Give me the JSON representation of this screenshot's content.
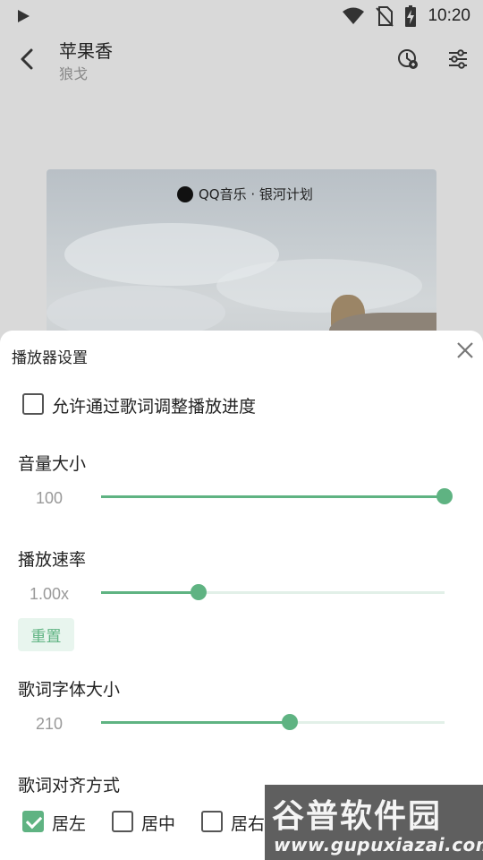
{
  "status_bar": {
    "time": "10:20"
  },
  "header": {
    "title": "苹果香",
    "artist": "狼戈"
  },
  "album_art": {
    "logo_text": "QQ音乐 · 银河计划"
  },
  "player_settings": {
    "title": "播放器设置",
    "lyrics_seek": {
      "label": "允许通过歌词调整播放进度",
      "checked": false
    },
    "volume": {
      "label": "音量大小",
      "value": "100",
      "fraction": 1.0
    },
    "speed": {
      "label": "播放速率",
      "value": "1.00x",
      "fraction": 0.285,
      "reset_label": "重置"
    },
    "font_size": {
      "label": "歌词字体大小",
      "value": "210",
      "fraction": 0.55
    },
    "alignment": {
      "label": "歌词对齐方式",
      "options": [
        {
          "label": "居左",
          "checked": true
        },
        {
          "label": "居中",
          "checked": false
        },
        {
          "label": "居右",
          "checked": false
        }
      ]
    }
  },
  "watermark": {
    "title": "谷普软件园",
    "url": "www.gupuxiazai.com"
  },
  "colors": {
    "accent": "#5fb382",
    "accent_light": "#e8f5ee",
    "scrim": "#d9d9d9"
  }
}
